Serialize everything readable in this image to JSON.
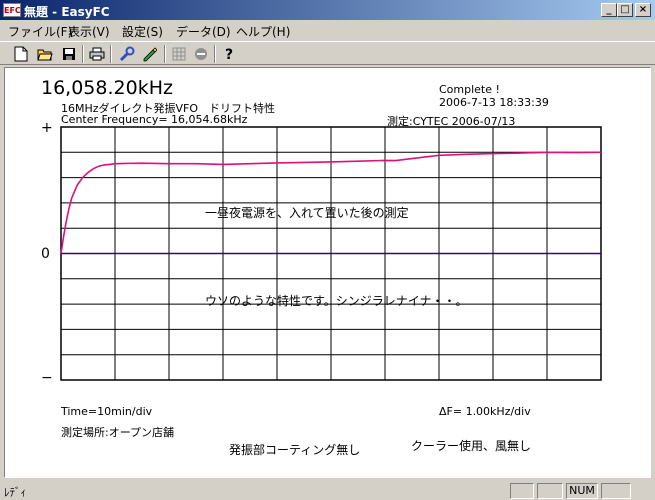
{
  "window": {
    "title": "無題 - EasyFC",
    "icon_label": "EFC"
  },
  "menu": [
    {
      "label": "ファイル(F)"
    },
    {
      "label": "表示(V)"
    },
    {
      "label": "設定(S)"
    },
    {
      "label": "データ(D)"
    },
    {
      "label": "ヘルプ(H)"
    }
  ],
  "toolbar_icons": [
    "new-icon",
    "open-icon",
    "save-icon",
    "print-icon",
    "wrench-icon",
    "pencil-icon",
    "grid-icon",
    "stop-icon",
    "help-icon"
  ],
  "measurement": {
    "frequency": "16,058.20kHz",
    "description": "16MHzダイレクト発振VFO　ドリフト特性",
    "center_frequency": "Center Frequency= 16,054.68kHz",
    "status": "Complete !",
    "datetime": "2006-7-13  18:33:39",
    "measured_by": "測定:CYTEC  2006-07/13",
    "note1": "一昼夜電源を、入れて置いた後の測定",
    "note2": "ウソのような特性です。シンジラレナイナ・・。",
    "time_div": "Time=10min/div",
    "delta_f": "ΔF=    1.00kHz/div",
    "location": "測定場所:オープン店舗",
    "comment1": "発振部コーティング無し",
    "comment2": "クーラー使用、風無し"
  },
  "axis": {
    "top_label": "+",
    "zero_label": "0",
    "bottom_label": "−"
  },
  "colors": {
    "trace": "#e0107a",
    "zero_line": "#2a0a7a",
    "grid": "#000000"
  },
  "chart_data": {
    "type": "line",
    "x_unit": "min",
    "y_unit": "kHz",
    "xlim": [
      0,
      100
    ],
    "ylim": [
      -5,
      5
    ],
    "x_divisions": 10,
    "y_divisions": 10,
    "series": [
      {
        "x": [
          0,
          0.5,
          1,
          1.5,
          2,
          3,
          4,
          5,
          6,
          7,
          8,
          9,
          10,
          12,
          15,
          20,
          25,
          30,
          35,
          40,
          45,
          50,
          55,
          60,
          62,
          65,
          70,
          75,
          80,
          85,
          90,
          95,
          100
        ],
        "y": [
          0.0,
          0.7,
          1.3,
          1.8,
          2.2,
          2.7,
          3.0,
          3.2,
          3.35,
          3.45,
          3.5,
          3.52,
          3.55,
          3.56,
          3.57,
          3.55,
          3.55,
          3.52,
          3.55,
          3.58,
          3.6,
          3.62,
          3.65,
          3.68,
          3.67,
          3.75,
          3.88,
          3.92,
          3.95,
          3.97,
          4.0,
          3.99,
          4.0
        ]
      }
    ]
  }
}
